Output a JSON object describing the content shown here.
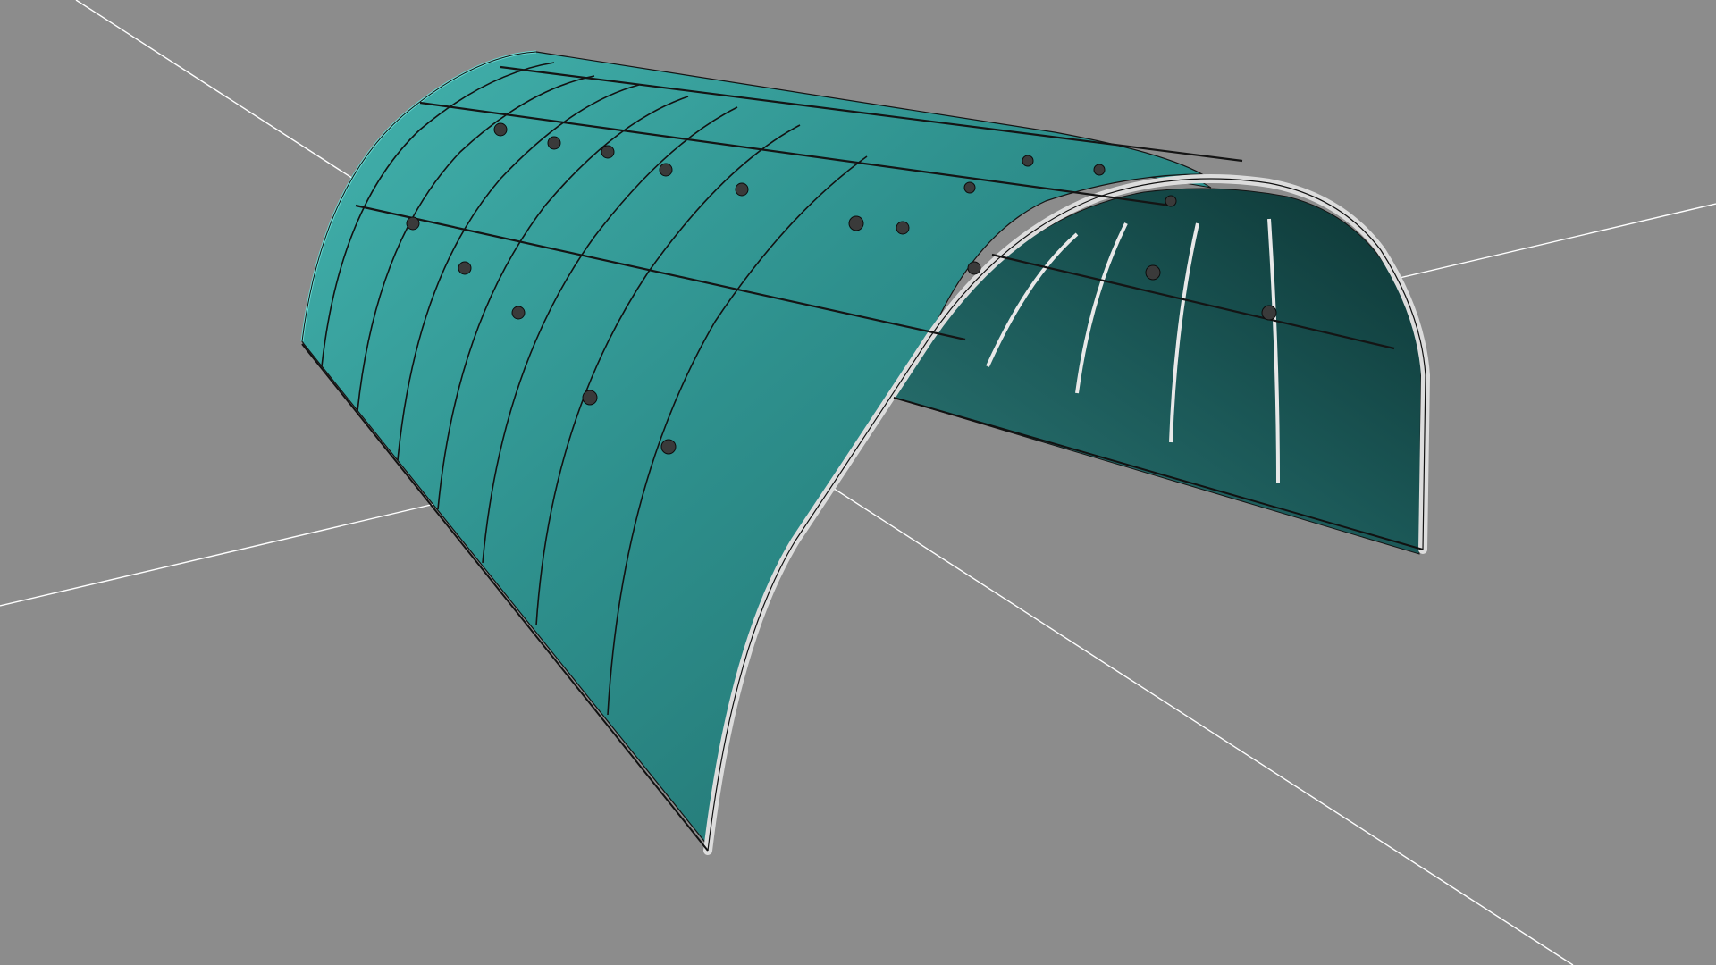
{
  "viewport": {
    "background_color": "#8c8c8c",
    "axis_color": "#ffffff",
    "shell_color_light": "#3aa7a3",
    "shell_color_mid": "#2b8a87",
    "shell_color_dark": "#0f3f3e",
    "wire_color": "#141414",
    "pipe_color": "#e4e4e4",
    "object_name": "",
    "icons": [
      "grid-axis-x",
      "grid-axis-y",
      "tunnel-shell",
      "arch-rib",
      "purlin-clamp"
    ]
  }
}
